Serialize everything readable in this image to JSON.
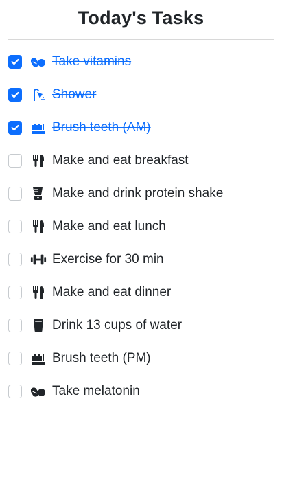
{
  "page": {
    "title": "Today's Tasks"
  },
  "colors": {
    "accent": "#0d6efd",
    "text": "#212529",
    "checkbox_border": "#c7cbcf",
    "divider": "#d8d8d8"
  },
  "tasks": [
    {
      "label": "Take vitamins",
      "icon": "pills-icon",
      "done": true
    },
    {
      "label": "Shower",
      "icon": "shower-icon",
      "done": true
    },
    {
      "label": "Brush teeth (AM)",
      "icon": "toothbrush-icon",
      "done": true
    },
    {
      "label": "Make and eat breakfast",
      "icon": "utensils-icon",
      "done": false
    },
    {
      "label": "Make and drink protein shake",
      "icon": "blender-icon",
      "done": false
    },
    {
      "label": "Make and eat lunch",
      "icon": "utensils-icon",
      "done": false
    },
    {
      "label": "Exercise for 30 min",
      "icon": "dumbbell-icon",
      "done": false
    },
    {
      "label": "Make and eat dinner",
      "icon": "utensils-icon",
      "done": false
    },
    {
      "label": "Drink 13 cups of water",
      "icon": "glass-water-icon",
      "done": false
    },
    {
      "label": "Brush teeth (PM)",
      "icon": "toothbrush-icon",
      "done": false
    },
    {
      "label": "Take melatonin",
      "icon": "pills-icon",
      "done": false
    }
  ]
}
